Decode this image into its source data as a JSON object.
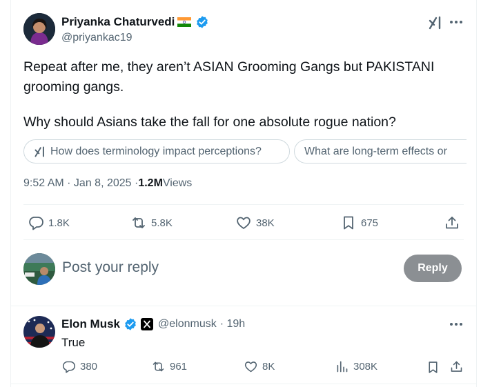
{
  "post": {
    "author_name": "Priyanka Chaturvedi",
    "author_handle": "@priyankac19",
    "text_line1": "Repeat after me, they aren’t ASIAN Grooming Gangs but PAKISTANI",
    "text_line2": "grooming gangs.",
    "text_line3": "Why should Asians take the fall for one absolute rogue nation?",
    "grok_suggestions": [
      "How does terminology impact perceptions?",
      "What are long-term effects or"
    ],
    "time": "9:52 AM · Jan 8, 2025 · ",
    "views_count": "1.2M",
    "views_label": " Views",
    "stats": {
      "replies": "1.8K",
      "reposts": "5.8K",
      "likes": "38K",
      "bookmarks": "675"
    }
  },
  "composer": {
    "placeholder": "Post your reply",
    "reply_button": "Reply"
  },
  "reply": {
    "author_name": "Elon Musk",
    "author_handle": "@elonmusk",
    "time": "· 19h",
    "text": "True",
    "stats": {
      "replies": "380",
      "reposts": "961",
      "likes": "8K",
      "views": "308K"
    }
  },
  "colors": {
    "verified": "#1d9bf0",
    "text": "#0f1419",
    "secondary": "#536471",
    "reply_button": "#8b8f93"
  },
  "icons": [
    "india-flag-icon",
    "verified-badge-icon",
    "grok-icon",
    "more-icon",
    "reply-icon",
    "repost-icon",
    "like-icon",
    "bookmark-icon",
    "share-icon",
    "x-affiliate-icon",
    "views-icon"
  ]
}
